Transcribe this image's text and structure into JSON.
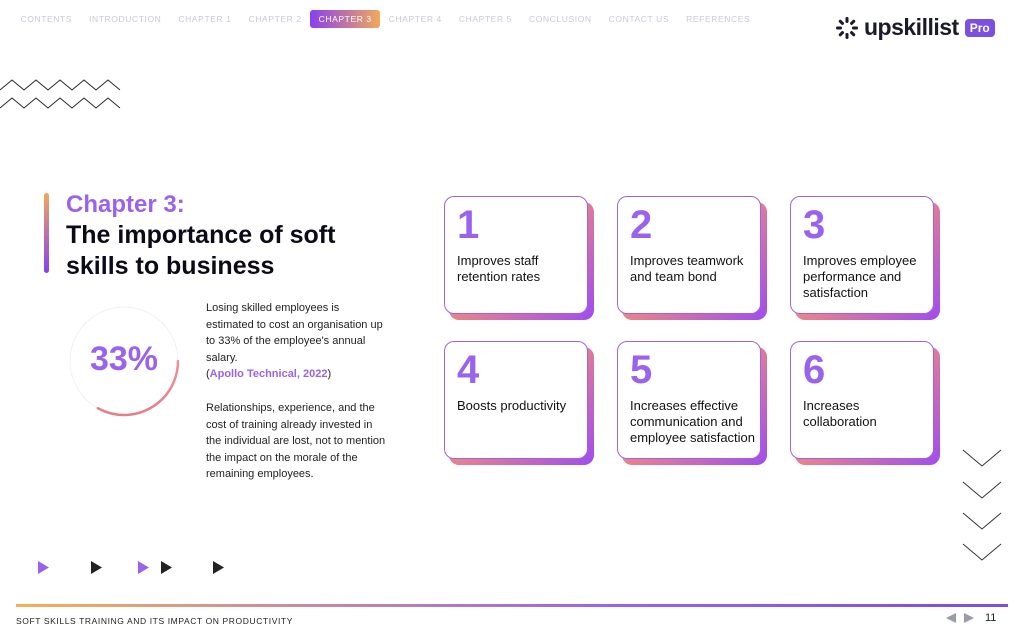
{
  "nav": {
    "items": [
      "CONTENTS",
      "INTRODUCTION",
      "CHAPTER 1",
      "CHAPTER 2",
      "CHAPTER 3",
      "CHAPTER 4",
      "CHAPTER 5",
      "CONCLUSION",
      "CONTACT US",
      "REFERENCES"
    ],
    "active_index": 4
  },
  "logo": {
    "text": "upskillist",
    "badge": "Pro"
  },
  "chapter": {
    "label": "Chapter 3:",
    "title": "The importance of soft skills to business"
  },
  "stat": {
    "value": "33%",
    "percent": 33
  },
  "paragraphs": {
    "p1": "Losing skilled employees is estimated to cost an organisation up to 33% of the employee's annual salary.",
    "citation_open": "(",
    "citation": "Apollo Technical, 2022",
    "citation_close": ")",
    "p2": "Relationships, experience, and the cost of training already invested in the individual are lost, not to mention the impact on the morale of the remaining employees."
  },
  "cards": [
    {
      "number": "1",
      "text": "Improves staff retention rates"
    },
    {
      "number": "2",
      "text": "Improves teamwork and team bond"
    },
    {
      "number": "3",
      "text": "Improves employee performance and satisfaction"
    },
    {
      "number": "4",
      "text": "Boosts productivity"
    },
    {
      "number": "5",
      "text": "Increases effective communication and employee satisfaction"
    },
    {
      "number": "6",
      "text": "Increases collaboration"
    }
  ],
  "footer": {
    "title": "SOFT SKILLS TRAINING AND ITS IMPACT ON PRODUCTIVITY",
    "page": "11"
  },
  "colors": {
    "accent": "#9a63ec",
    "accent_dark": "#7b4fe0",
    "warm": "#f3b057"
  },
  "icons": [
    "prev-page-icon",
    "next-page-icon",
    "chevron-down-icon",
    "play-triangle-icon"
  ]
}
